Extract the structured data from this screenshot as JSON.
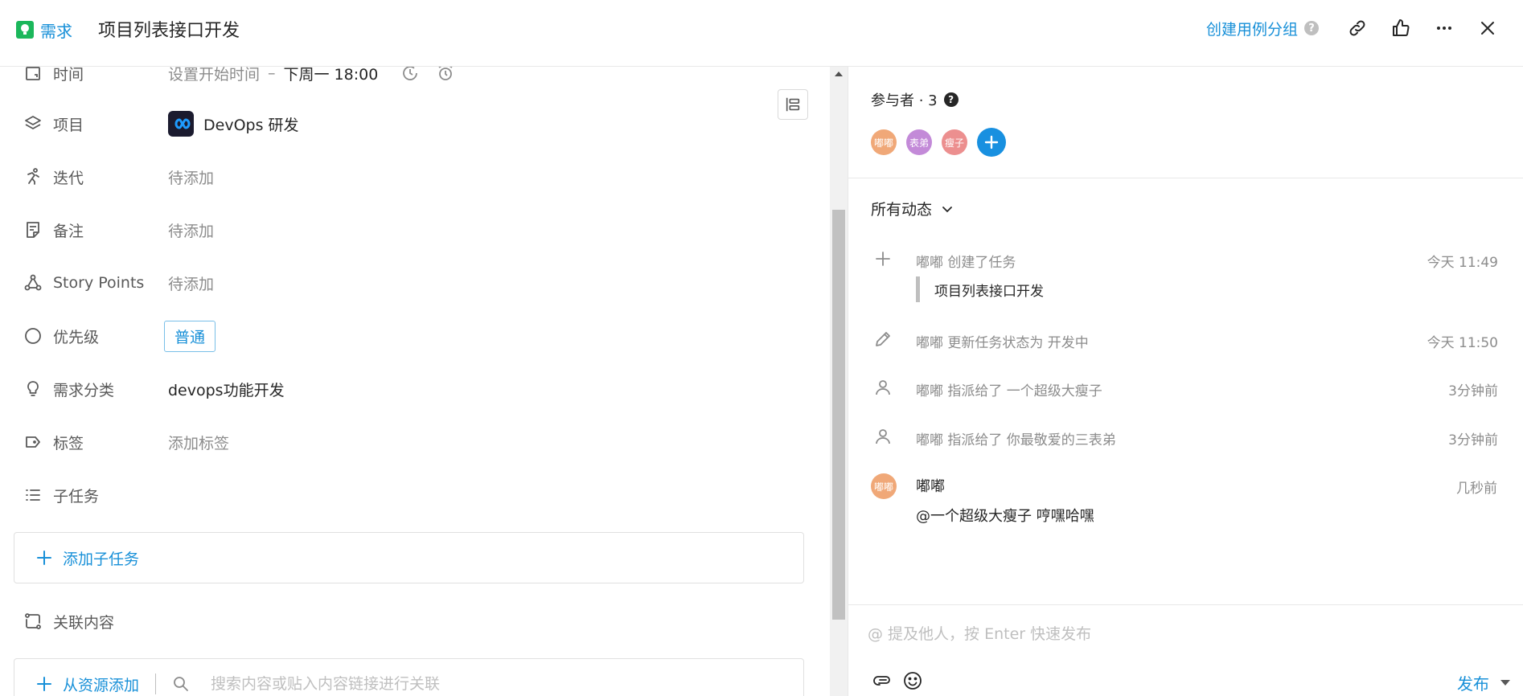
{
  "header": {
    "type_label": "需求",
    "title": "项目列表接口开发",
    "case_group_link": "创建用例分组",
    "help": "?"
  },
  "fields": {
    "time": {
      "label": "时间",
      "start_placeholder": "设置开始时间",
      "separator": "–",
      "end": "下周一 18:00"
    },
    "project": {
      "label": "项目",
      "value": "DevOps 研发"
    },
    "iteration": {
      "label": "迭代",
      "value": "待添加"
    },
    "note": {
      "label": "备注",
      "value": "待添加"
    },
    "story_points": {
      "label": "Story Points",
      "value": "待添加"
    },
    "priority": {
      "label": "优先级",
      "value": "普通"
    },
    "category": {
      "label": "需求分类",
      "value": "devops功能开发"
    },
    "tags": {
      "label": "标签",
      "value": "添加标签"
    },
    "subtasks": {
      "label": "子任务",
      "add_label": "添加子任务"
    },
    "related": {
      "label": "关联内容",
      "add_label": "从资源添加",
      "search_placeholder": "搜索内容或贴入内容链接进行关联"
    }
  },
  "participants": {
    "label": "参与者 · 3",
    "help": "?",
    "avatars": [
      {
        "text": "嘟嘟",
        "color": "#f0a878"
      },
      {
        "text": "表弟",
        "color": "#c38ad8"
      },
      {
        "text": "瘦子",
        "color": "#ec8f8f"
      }
    ]
  },
  "activity": {
    "filter_label": "所有动态",
    "items": [
      {
        "icon": "plus-icon",
        "text": "嘟嘟 创建了任务",
        "time": "今天 11:49",
        "quote": "项目列表接口开发"
      },
      {
        "icon": "pencil-icon",
        "text": "嘟嘟 更新任务状态为 开发中",
        "time": "今天 11:50"
      },
      {
        "icon": "user-icon",
        "text": "嘟嘟 指派给了 一个超级大瘦子",
        "time": "3分钟前"
      },
      {
        "icon": "user-icon",
        "text": "嘟嘟 指派给了 你最敬爱的三表弟",
        "time": "3分钟前"
      }
    ],
    "comment": {
      "avatar": "嘟嘟",
      "avatar_color": "#f0a878",
      "author": "嘟嘟",
      "time": "几秒前",
      "body": "@一个超级大瘦子 哼嘿哈嘿"
    }
  },
  "composer": {
    "placeholder": "@ 提及他人，按 Enter 快速发布",
    "publish_label": "发布"
  },
  "colors": {
    "accent": "#1890d8",
    "type_green": "#1bb75b"
  }
}
